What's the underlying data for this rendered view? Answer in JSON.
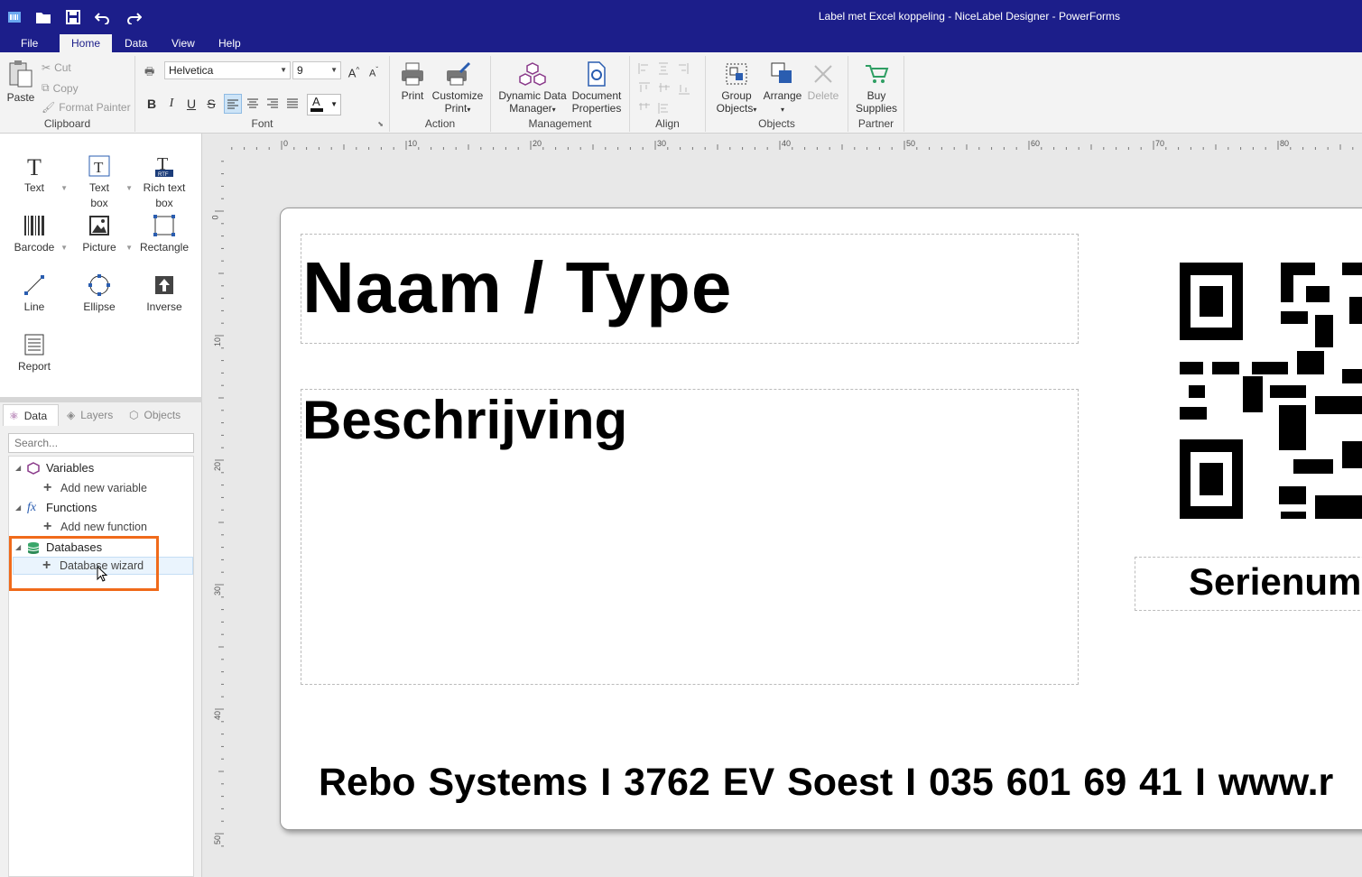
{
  "window": {
    "title": "Label met Excel koppeling - NiceLabel Designer - PowerForms"
  },
  "menu_tabs": [
    {
      "label": "File"
    },
    {
      "label": "Home"
    },
    {
      "label": "Data"
    },
    {
      "label": "View"
    },
    {
      "label": "Help"
    }
  ],
  "ribbon": {
    "clipboard": {
      "label": "Clipboard",
      "paste": "Paste",
      "cut": "Cut",
      "copy": "Copy",
      "format_painter": "Format Painter"
    },
    "font": {
      "label": "Font",
      "family": "Helvetica",
      "size": "9"
    },
    "action": {
      "label": "Action",
      "print": "Print",
      "customize_print_1": "Customize",
      "customize_print_2": "Print"
    },
    "management": {
      "label": "Management",
      "ddm_1": "Dynamic Data",
      "ddm_2": "Manager",
      "docprops_1": "Document",
      "docprops_2": "Properties"
    },
    "align": {
      "label": "Align"
    },
    "objects": {
      "label": "Objects",
      "group_1": "Group",
      "group_2": "Objects",
      "arrange": "Arrange",
      "delete": "Delete"
    },
    "partner": {
      "label": "Partner",
      "buy_1": "Buy",
      "buy_2": "Supplies"
    }
  },
  "toolbox": {
    "text": "Text",
    "textbox_1": "Text",
    "textbox_2": "box",
    "richtext_1": "Rich text",
    "richtext_2": "box",
    "barcode": "Barcode",
    "picture": "Picture",
    "rectangle": "Rectangle",
    "line": "Line",
    "ellipse": "Ellipse",
    "inverse": "Inverse",
    "report": "Report"
  },
  "panel": {
    "tabs": {
      "data": "Data",
      "layers": "Layers",
      "objects": "Objects"
    },
    "search_placeholder": "Search...",
    "tree": {
      "variables": "Variables",
      "add_variable": "Add new variable",
      "functions": "Functions",
      "add_function": "Add new function",
      "databases": "Databases",
      "database_wizard": "Database wizard"
    }
  },
  "rulers": {
    "h": [
      "0",
      "10",
      "20",
      "30",
      "40",
      "50",
      "60",
      "70",
      "80"
    ],
    "v": [
      "0",
      "10",
      "20",
      "30",
      "40",
      "50"
    ]
  },
  "label": {
    "naam": "Naam / Type",
    "beschrijving": "Beschrijving",
    "serienummer": "Serienum",
    "footer": "Rebo Systems  I  3762 EV Soest  I  035 601 69 41  I  www.r"
  },
  "colors": {
    "titlebar": "#1c1e8a",
    "highlight": "#f06a1a"
  }
}
